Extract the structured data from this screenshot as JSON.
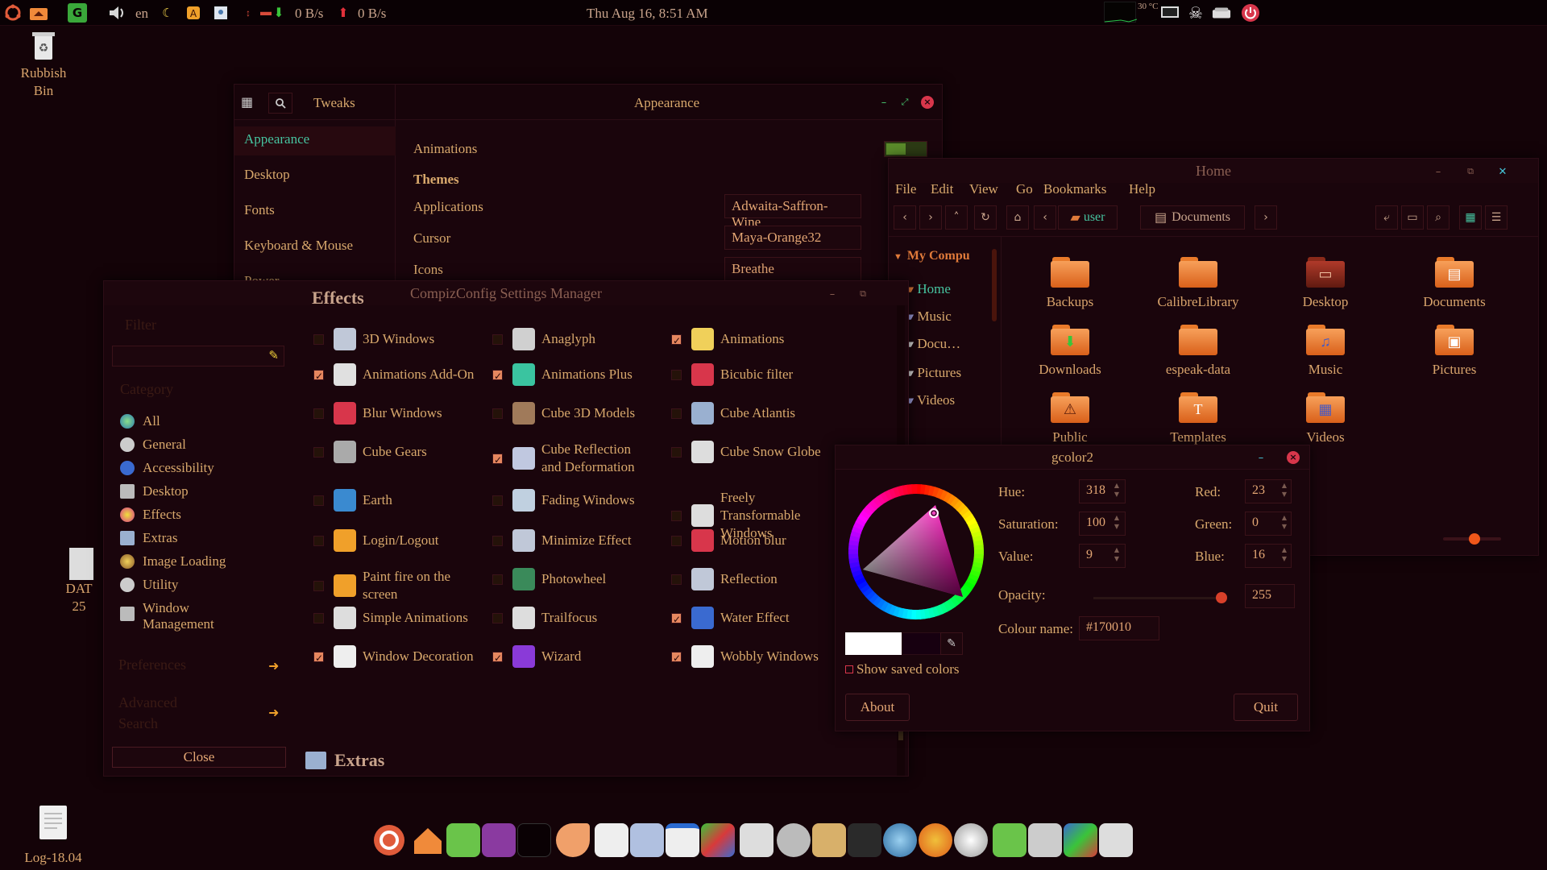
{
  "top_panel": {
    "keyboard_layout": "en",
    "net_down": "0 B/s",
    "net_up": "0 B/s",
    "clock": "Thu Aug 16,  8:51 AM",
    "temperature": "30 °C",
    "icons": [
      "ubuntu-logo-icon",
      "home-folder-icon",
      "g-app-icon",
      "volume-icon",
      "moon-icon",
      "app-icon",
      "image-icon",
      "network-icon",
      "shutdown-icon"
    ]
  },
  "desktop": {
    "rubbish_bin": "Rubbish\nBin",
    "log_file": "Log-18.04",
    "partial_icon": "DAT\n25"
  },
  "tweaks": {
    "app_title": "Tweaks",
    "page_title": "Appearance",
    "sidebar": [
      "Appearance",
      "Desktop",
      "Fonts",
      "Keyboard & Mouse",
      "Power"
    ],
    "animations_label": "Animations",
    "animations_on": true,
    "themes_heading": "Themes",
    "rows": [
      {
        "label": "Applications",
        "value": "Adwaita-Saffron-Wine"
      },
      {
        "label": "Cursor",
        "value": "Maya-Orange32"
      },
      {
        "label": "Icons",
        "value": "Breathe"
      }
    ]
  },
  "nautilus": {
    "title": "Home",
    "menu": [
      "File",
      "Edit",
      "View",
      "Go",
      "Bookmarks",
      "Help"
    ],
    "path": [
      "user",
      "Documents"
    ],
    "places_header": "My Compu",
    "places": [
      "Home",
      "Music",
      "Docu…",
      "Pictures",
      "Videos"
    ],
    "files": [
      "Backups",
      "CalibreLibrary",
      "Desktop",
      "Documents",
      "Downloads",
      "espeak-data",
      "Music",
      "Pictures",
      "Public",
      "Templates",
      "Videos"
    ]
  },
  "ccsm": {
    "title": "CompizConfig Settings Manager",
    "filter_label": "Filter",
    "category_label": "Category",
    "categories": [
      "All",
      "General",
      "Accessibility",
      "Desktop",
      "Effects",
      "Extras",
      "Image Loading",
      "Utility",
      "Window Management"
    ],
    "preferences_label": "Preferences",
    "advanced_search_label": "Advanced Search",
    "close_label": "Close",
    "section_effects": "Effects",
    "section_extras": "Extras",
    "plugins": [
      {
        "name": "3D Windows",
        "on": false
      },
      {
        "name": "Anaglyph",
        "on": false
      },
      {
        "name": "Animations",
        "on": true
      },
      {
        "name": "Animations Add-On",
        "on": true
      },
      {
        "name": "Animations Plus",
        "on": true
      },
      {
        "name": "Bicubic filter",
        "on": false
      },
      {
        "name": "Blur Windows",
        "on": false
      },
      {
        "name": "Cube 3D Models",
        "on": false
      },
      {
        "name": "Cube Atlantis",
        "on": false
      },
      {
        "name": "Cube Gears",
        "on": false
      },
      {
        "name": "Cube Reflection and Deformation",
        "on": true
      },
      {
        "name": "Cube Snow Globe",
        "on": false
      },
      {
        "name": "Earth",
        "on": false
      },
      {
        "name": "Fading Windows",
        "on": false
      },
      {
        "name": "Freely Transformable Windows",
        "on": false
      },
      {
        "name": "Login/Logout",
        "on": false
      },
      {
        "name": "Minimize Effect",
        "on": false
      },
      {
        "name": "Motion blur",
        "on": false
      },
      {
        "name": "Paint fire on the screen",
        "on": false
      },
      {
        "name": "Photowheel",
        "on": false
      },
      {
        "name": "Reflection",
        "on": false
      },
      {
        "name": "Simple Animations",
        "on": false
      },
      {
        "name": "Trailfocus",
        "on": false
      },
      {
        "name": "Water Effect",
        "on": true
      },
      {
        "name": "Window Decoration",
        "on": true
      },
      {
        "name": "Wizard",
        "on": true
      },
      {
        "name": "Wobbly Windows",
        "on": true
      }
    ]
  },
  "gcolor2": {
    "title": "gcolor2",
    "hue_label": "Hue:",
    "hue": "318",
    "saturation_label": "Saturation:",
    "saturation": "100",
    "value_label": "Value:",
    "value": "9",
    "red_label": "Red:",
    "red": "23",
    "green_label": "Green:",
    "green": "0",
    "blue_label": "Blue:",
    "blue": "16",
    "opacity_label": "Opacity:",
    "opacity": "255",
    "colour_name_label": "Colour name:",
    "colour_name": "#170010",
    "show_saved": "Show saved colors",
    "about": "About",
    "quit": "Quit"
  },
  "dock": {
    "icons": [
      "ubuntu-icon",
      "home-icon",
      "files-icon",
      "terminal-icon",
      "window-icon",
      "hand-icon",
      "text-editor-icon",
      "image-viewer-icon",
      "document-icon",
      "cube-icon",
      "audio-icon",
      "settings-icon",
      "package-icon",
      "network-icon",
      "browser-globe-icon",
      "firefox-icon",
      "brightness-icon",
      "folder-icon",
      "disk-icon",
      "compiz-cube-icon",
      "mixer-icon"
    ]
  },
  "colors": {
    "accent": "#e6875f",
    "text": "#d8a86c",
    "background": "#140308",
    "window": "#1a050c",
    "green": "#46c46e",
    "close": "#d8364b"
  }
}
